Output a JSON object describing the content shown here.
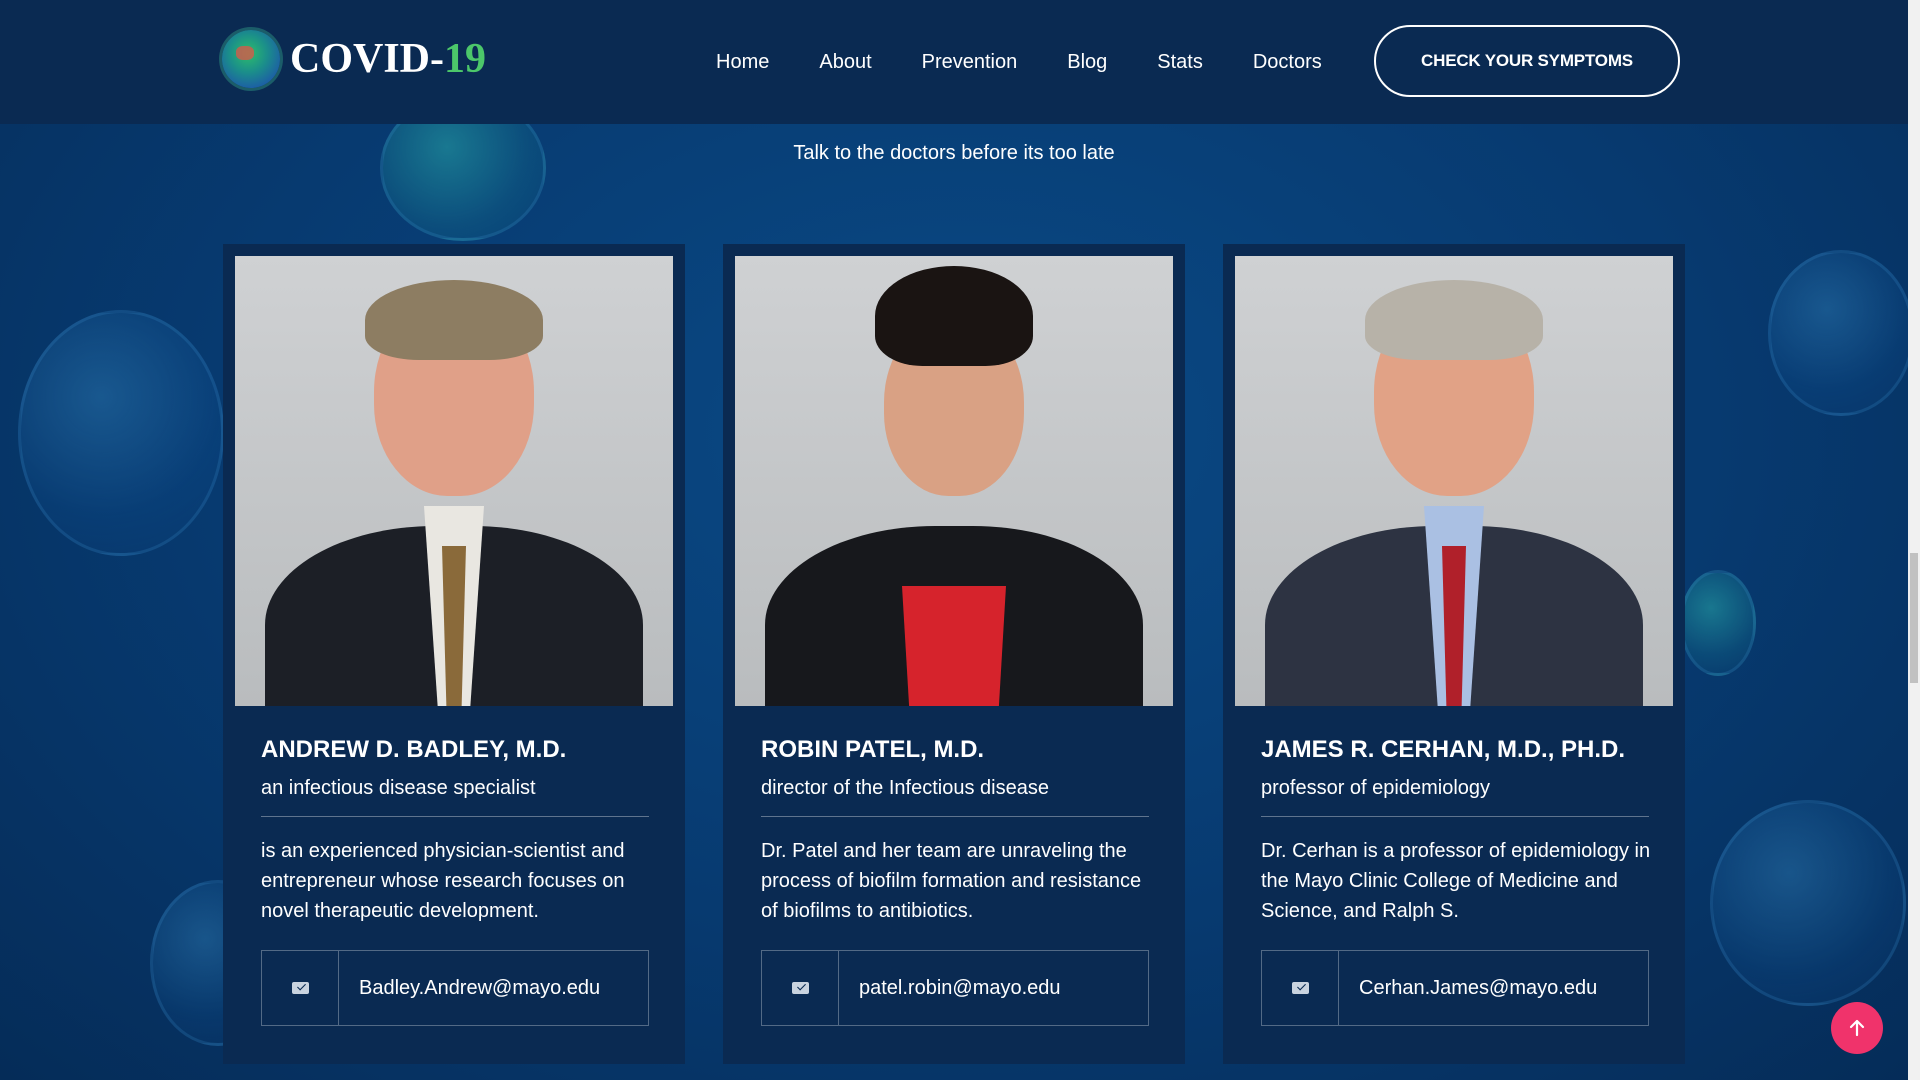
{
  "brand": {
    "name_prefix": "COVID-",
    "name_number": "19",
    "logo_icon": "globe-virus-icon"
  },
  "nav": {
    "items": [
      {
        "label": "Home"
      },
      {
        "label": "About"
      },
      {
        "label": "Prevention"
      },
      {
        "label": "Blog"
      },
      {
        "label": "Stats"
      },
      {
        "label": "Doctors"
      }
    ],
    "cta_label": "CHECK YOUR SYMPTOMS"
  },
  "doctors_section": {
    "tagline": "Talk to the doctors before its too late",
    "doctors": [
      {
        "name": "ANDREW D. BADLEY, M.D.",
        "role": "an infectious disease specialist",
        "description": "is an experienced physician-scientist and entrepreneur whose research focuses on novel therapeutic development.",
        "email": "Badley.Andrew@mayo.edu",
        "email_icon": "mail-icon"
      },
      {
        "name": "ROBIN PATEL, M.D.",
        "role": "director of the Infectious disease",
        "description": "Dr. Patel and her team are unraveling the process of biofilm formation and resistance of biofilms to antibiotics.",
        "email": "patel.robin@mayo.edu",
        "email_icon": "mail-icon"
      },
      {
        "name": "JAMES R. CERHAN, M.D., PH.D.",
        "role": "professor of epidemiology",
        "description": "Dr. Cerhan is a professor of epidemiology in the Mayo Clinic College of Medicine and Science, and Ralph S.",
        "email": "Cerhan.James@mayo.edu",
        "email_icon": "mail-icon"
      }
    ]
  },
  "scroll_top_icon": "arrow-up-icon",
  "colors": {
    "background": "#073a70",
    "header": "#0a2a52",
    "card": "#0a2a52",
    "accent_green": "#4cc76a",
    "scroll_top": "#f0336b"
  }
}
